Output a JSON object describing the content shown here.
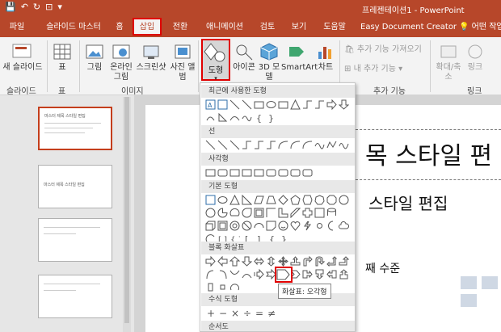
{
  "titlebar": {
    "quick_access": [
      "💾",
      "↶",
      "↻",
      "⊡",
      "▾"
    ],
    "title": "프레젠테이션1 - PowerPoint"
  },
  "tabs": [
    "파일",
    "슬라이드 마스터",
    "홈",
    "삽입",
    "전환",
    "애니메이션",
    "검토",
    "보기",
    "도움말",
    "Easy Document Creator",
    "어떤 작업"
  ],
  "tab_search_icon": "lightbulb-icon",
  "ribbon": {
    "new_slide": "새 슬라이드",
    "table": "표",
    "picture": "그림",
    "online_picture": "온라인 그림",
    "screenshot": "스크린샷",
    "photo_album": "사진 앨범",
    "shapes": "도형",
    "icons": "아이콘",
    "models_3d": "3D 모델",
    "smartart": "SmartArt",
    "chart": "차트",
    "get_addins": "추가 기능 가져오기",
    "my_addins": "내 추가 기능",
    "zoom": "확대/축소",
    "link": "링크",
    "groups": {
      "slides": "슬라이드",
      "tables": "표",
      "images": "이미지",
      "addins": "추가 기능",
      "links": "링크"
    }
  },
  "thumbnails": [
    {
      "title": "마스터 제목 스타일 편집"
    },
    {
      "title": "마스터 제목 스타일 편집"
    },
    {
      "title": ""
    },
    {
      "title": ""
    }
  ],
  "slide": {
    "title": "목 스타일 편",
    "subtitle": "스타일 편집",
    "level_text": "째 수준",
    "small_text": "수"
  },
  "gallery": {
    "sections": [
      "최근에 사용한 도형",
      "선",
      "사각형",
      "기본 도형",
      "블록 화살표",
      "수식 도형",
      "순서도"
    ]
  },
  "tooltip": "화살표: 오각형",
  "colors": {
    "accent": "#b7472a",
    "highlight": "#e00000",
    "selected_thumb": "#c43e1c"
  }
}
